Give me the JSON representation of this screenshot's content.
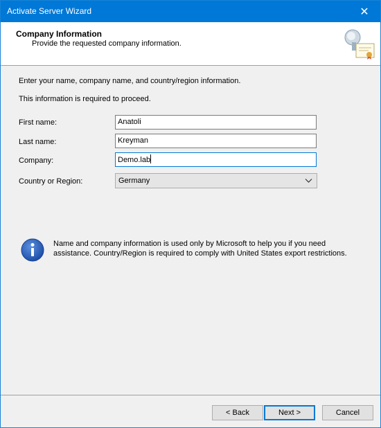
{
  "window": {
    "title": "Activate Server Wizard",
    "close_glyph": "✕"
  },
  "header": {
    "title": "Company Information",
    "subtitle": "Provide the requested company information.",
    "icon": "certificate-server-icon"
  },
  "intro": {
    "line1": "Enter your name, company name, and country/region information.",
    "line2": "This information is required to proceed."
  },
  "form": {
    "first_name_label": "First name:",
    "first_name_value": "Anatoli",
    "last_name_label": "Last name:",
    "last_name_value": "Kreyman",
    "company_label": "Company:",
    "company_value": "Demo.lab",
    "country_label": "Country or Region:",
    "country_value": "Germany"
  },
  "info": {
    "icon": "info-icon",
    "text": "Name and company information is used only by Microsoft to help you if you need assistance. Country/Region is required to comply with United States export restrictions."
  },
  "buttons": {
    "back": "< Back",
    "next": "Next >",
    "cancel": "Cancel"
  },
  "colors": {
    "titlebar": "#0078d7",
    "dialog_bg": "#f0f0f0",
    "focus_border": "#0078d7",
    "info_blue": "#1e4fa8"
  }
}
